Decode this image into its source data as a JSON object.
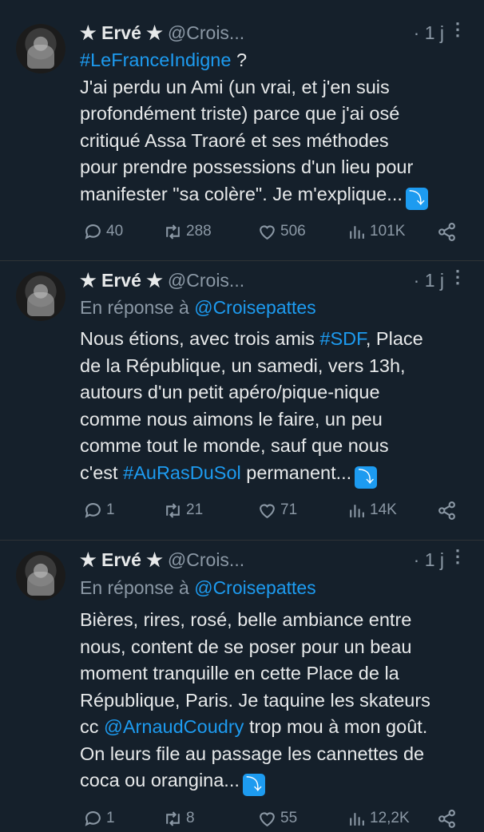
{
  "tweets": [
    {
      "name": "★ Ervé ★",
      "handle": "@Croisepattes",
      "handle_display": "@Crois...",
      "time": "· 1 j",
      "reply_prefix": "",
      "reply_handle": "",
      "body_parts": [
        {
          "t": "#LeFranceIndigne",
          "link": true
        },
        {
          "t": " ?",
          "link": false
        }
      ],
      "body_lines": [
        "J'ai perdu un Ami (un vrai, et j'en suis",
        "profondément triste) parce que j'ai osé",
        "critiqué Assa Traoré et ses méthodes",
        "pour prendre possessions d'un lieu pour",
        "manifester \"sa colère\". Je m'explique..."
      ],
      "stats": {
        "replies": "40",
        "retweets": "288",
        "likes": "506",
        "views": "101K"
      }
    },
    {
      "name": "★ Ervé ★",
      "handle_display": "@Crois...",
      "time": "· 1 j",
      "reply_prefix": "En réponse à ",
      "reply_handle": "@Croisepattes",
      "line1_a": "Nous étions, avec trois amis ",
      "line1_tag": "#SDF",
      "line1_b": ", Place",
      "lines": [
        "de la République, un samedi, vers 13h,",
        "autours d'un petit apéro/pique-nique",
        "comme nous aimons le faire, un peu",
        "comme tout le monde, sauf que nous"
      ],
      "last_a": "c'est ",
      "last_tag": "#AuRasDuSol",
      "last_b": " permanent...",
      "stats": {
        "replies": "1",
        "retweets": "21",
        "likes": "71",
        "views": "14K"
      }
    },
    {
      "name": "★ Ervé ★",
      "handle_display": "@Crois...",
      "time": "· 1 j",
      "reply_prefix": "En réponse à ",
      "reply_handle": "@Croisepattes",
      "lines": [
        "Bières, rires, rosé, belle ambiance entre",
        "nous, content de se poser pour un beau",
        "moment tranquille en cette Place de la",
        "République, Paris. Je taquine les skateurs"
      ],
      "cc_a": "cc ",
      "cc_tag": "@ArnaudCoudry",
      "cc_b": " trop mou à mon goût.",
      "lines2": [
        "On leurs file au passage les cannettes de"
      ],
      "last": "coca ou orangina...",
      "stats": {
        "replies": "1",
        "retweets": "8",
        "likes": "55",
        "views": "12,2K"
      }
    }
  ],
  "emoji": "⤵",
  "more_icon": "⋮"
}
